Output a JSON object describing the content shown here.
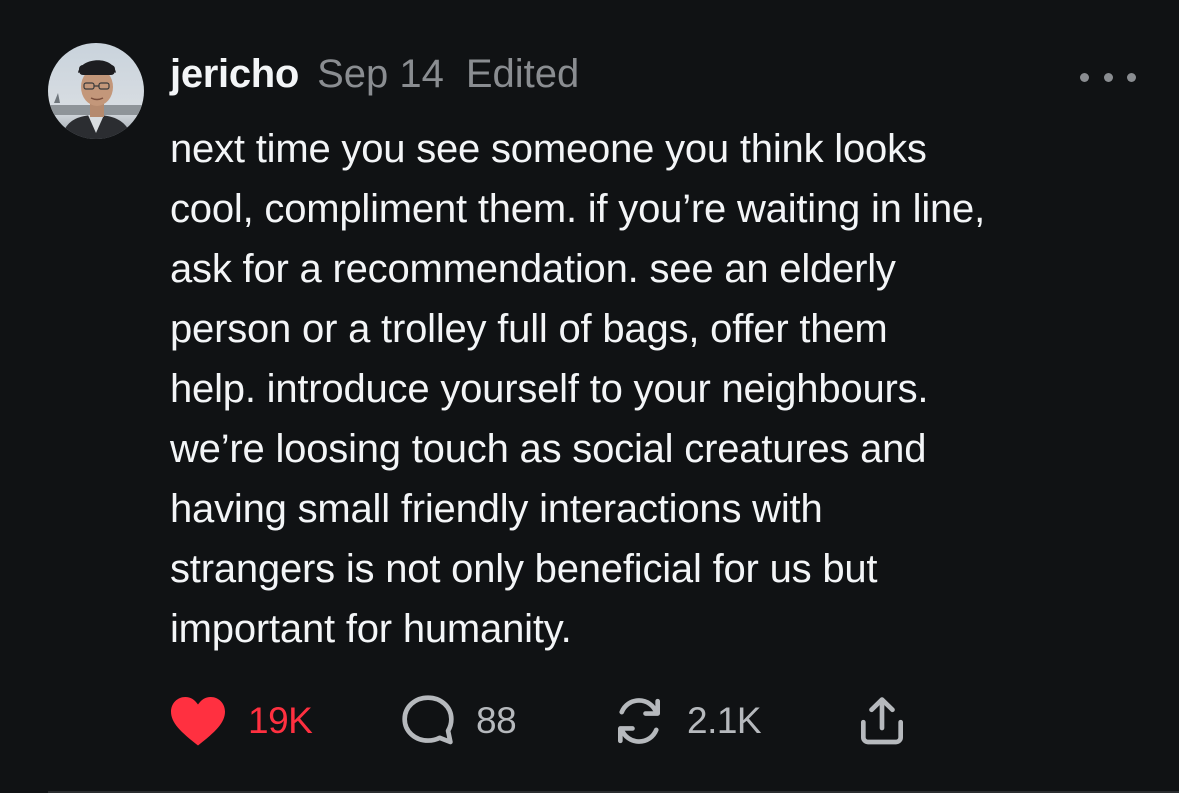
{
  "post": {
    "author": {
      "username": "jericho",
      "avatar_icon": "user-avatar-photo"
    },
    "date": "Sep 14",
    "edited_label": "Edited",
    "more_icon": "ellipsis-icon",
    "body_lines": [
      "next time you see someone you think looks",
      "cool, compliment them. if you’re waiting in line,",
      "ask for a recommendation. see an elderly",
      "person or a trolley full of bags, offer them",
      "help. introduce yourself to your neighbours.",
      "we’re loosing touch as social creatures and",
      "having small friendly interactions with",
      "strangers is not only beneficial for us but",
      "important for humanity."
    ],
    "actions": {
      "likes": "19K",
      "replies": "88",
      "reposts": "2.1K",
      "like_icon": "heart-icon",
      "reply_icon": "speech-bubble-icon",
      "repost_icon": "repost-icon",
      "share_icon": "share-icon"
    }
  },
  "colors": {
    "background": "#101214",
    "primary_text": "#f3f5f7",
    "secondary_text": "#8a8d91",
    "like_red": "#ff3040"
  }
}
